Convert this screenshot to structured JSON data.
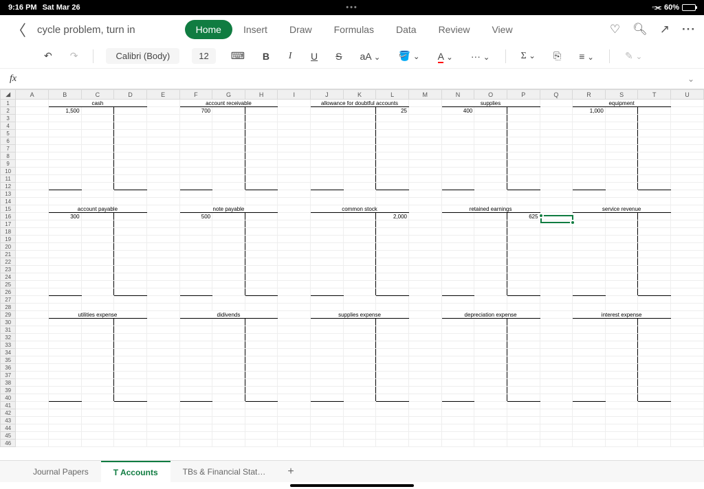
{
  "status": {
    "time": "9:16 PM",
    "date": "Sat Mar 26",
    "battery": "60%"
  },
  "doc_title": "cycle problem, turn in",
  "ribbon": {
    "home": "Home",
    "insert": "Insert",
    "draw": "Draw",
    "formulas": "Formulas",
    "data": "Data",
    "review": "Review",
    "view": "View"
  },
  "toolbar": {
    "font": "Calibri (Body)",
    "size": "12",
    "bold": "B",
    "italic": "I",
    "underline": "U",
    "strike": "S",
    "textsize": "aA",
    "fill": "⬚",
    "fontcolor": "A",
    "more": "···",
    "sigma": "Σ"
  },
  "formula_bar": {
    "fx": "fx"
  },
  "columns": [
    "A",
    "B",
    "C",
    "D",
    "E",
    "F",
    "G",
    "H",
    "I",
    "J",
    "K",
    "L",
    "M",
    "N",
    "O",
    "P",
    "Q",
    "R",
    "S",
    "T",
    "U"
  ],
  "rows": 46,
  "cells": {
    "r1": {
      "cash": "cash",
      "ar": "account receivable",
      "ada": "allowance for doubtful accounts",
      "supplies": "supplies",
      "equip": "equipment"
    },
    "r2": {
      "cash_v": "1,500",
      "ar_v": "700",
      "ada_v": "25",
      "supplies_v": "400",
      "equip_v": "1,000"
    },
    "r15": {
      "ap": "account payable",
      "np": "note payable",
      "cs": "common stock",
      "re": "retained earnings",
      "sr": "service revenue"
    },
    "r16": {
      "ap_v": "300",
      "np_v": "500",
      "cs_v": "2,000",
      "re_v": "625"
    },
    "r29": {
      "ue": "utilities expense",
      "div": "didivends",
      "se": "supplies expense",
      "de": "depreciation expense",
      "ie": "interest expense"
    }
  },
  "sheets": {
    "s1": "Journal Papers",
    "s2": "T Accounts",
    "s3": "TBs & Financial Stat…"
  }
}
